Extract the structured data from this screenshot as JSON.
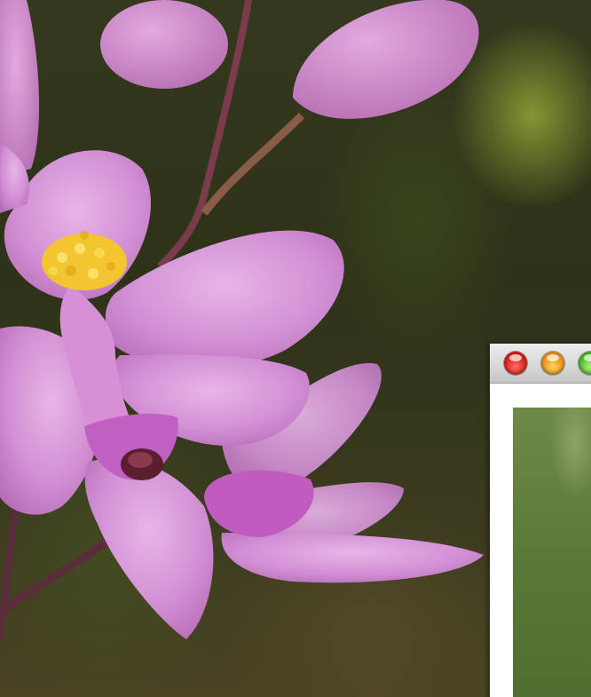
{
  "window": {
    "controls": [
      {
        "name": "close",
        "color": "#e0241b"
      },
      {
        "name": "minimize",
        "color": "#f2a12a"
      },
      {
        "name": "zoom",
        "color": "#5cc431"
      }
    ]
  },
  "colors": {
    "petal": "#d28fd4",
    "petal_dark": "#a85aa8",
    "stamen": "#f2c531",
    "background": "#2e3318"
  }
}
